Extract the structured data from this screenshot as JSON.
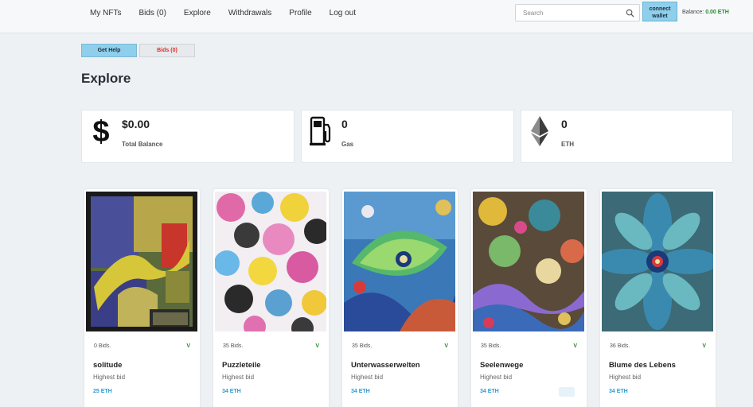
{
  "nav": {
    "items": [
      "My NFTs",
      "Bids (0)",
      "Explore",
      "Withdrawals",
      "Profile",
      "Log out"
    ]
  },
  "search": {
    "placeholder": "Search"
  },
  "wallet": {
    "connect_label_1": "connect",
    "connect_label_2": "wallet",
    "balance_label": "Balance:",
    "balance_value": "0.00 ETH"
  },
  "actions": {
    "help_label": "Get Help",
    "bids_label": "Bids (0)"
  },
  "page": {
    "title": "Explore"
  },
  "stats": [
    {
      "value": "$0.00",
      "label": "Total Balance",
      "icon": "dollar-icon"
    },
    {
      "value": "0",
      "label": "Gas",
      "icon": "gas-pump-icon"
    },
    {
      "value": "0",
      "label": "ETH",
      "icon": "ethereum-icon"
    }
  ],
  "cards": [
    {
      "bids": "0 Bids.",
      "flag": "V",
      "name": "solitude",
      "highest_label": "Highest bid",
      "price": "25 ETH"
    },
    {
      "bids": "35 Bids.",
      "flag": "V",
      "name": "Puzzleteile",
      "highest_label": "Highest bid",
      "price": "34 ETH"
    },
    {
      "bids": "35 Bids.",
      "flag": "V",
      "name": "Unterwasserwelten",
      "highest_label": "Highest bid",
      "price": "34 ETH"
    },
    {
      "bids": "35 Bids.",
      "flag": "V",
      "name": "Seelenwege",
      "highest_label": "Highest bid",
      "price": "34 ETH"
    },
    {
      "bids": "36 Bids.",
      "flag": "V",
      "name": "Blume des Lebens",
      "highest_label": "Highest bid",
      "price": "34 ETH"
    }
  ],
  "colors": {
    "accent": "#8fcfec",
    "price": "#2e9ad0",
    "positive": "#2a8a2a",
    "alert": "#d9302b"
  }
}
